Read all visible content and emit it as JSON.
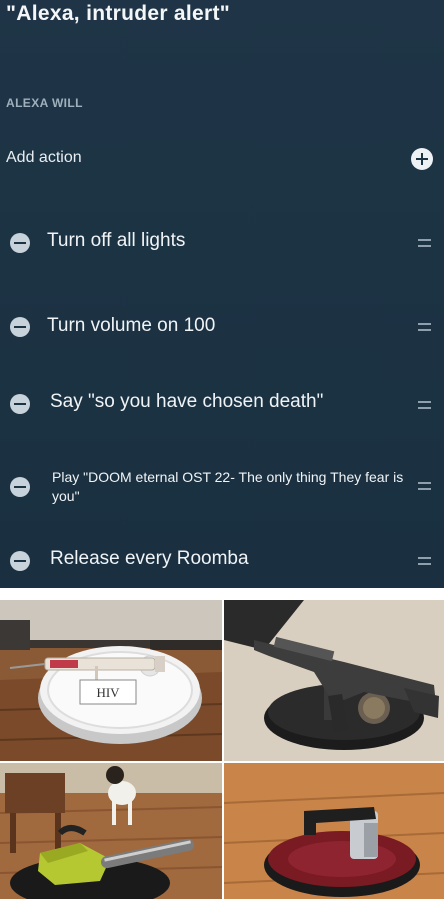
{
  "alexa": {
    "title": "\"Alexa, intruder alert\"",
    "section_header": "ALEXA WILL",
    "add_action_label": "Add action",
    "actions": [
      {
        "label": "Turn off all lights"
      },
      {
        "label": "Turn volume on 100"
      },
      {
        "label": "Say \"so you have chosen death\""
      },
      {
        "label": "Play \"DOOM eternal OST 22- The only thing They fear is you\""
      },
      {
        "label": "Release every Roomba"
      }
    ]
  },
  "photos": {
    "syringe_label": "HIV"
  },
  "colors": {
    "panel_bg": "#1c3344",
    "text": "#f1f4f6",
    "muted": "#9fb0bd"
  }
}
